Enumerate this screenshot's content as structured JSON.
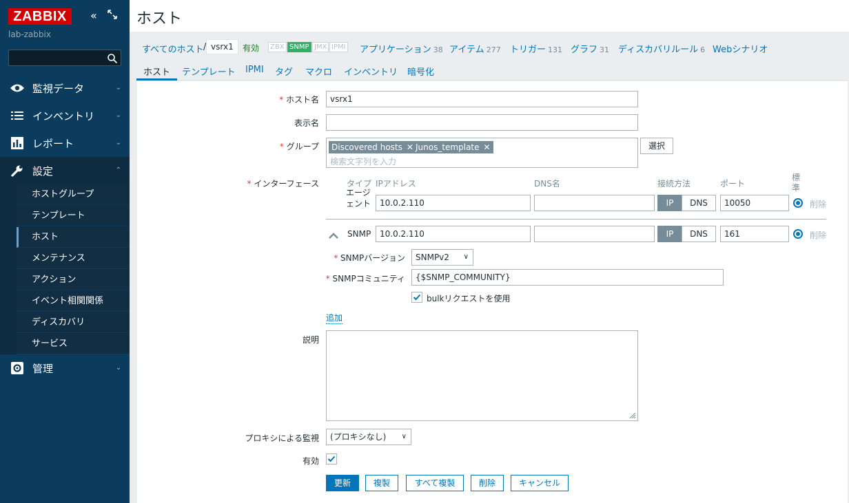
{
  "sidebar": {
    "logo": "ZABBIX",
    "server_name": "lab-zabbix",
    "collapse_glyph": "«",
    "sections": [
      {
        "label": "監視データ",
        "icon": "eye-icon"
      },
      {
        "label": "インベントリ",
        "icon": "list-icon"
      },
      {
        "label": "レポート",
        "icon": "bar-chart-icon"
      },
      {
        "label": "設定",
        "icon": "wrench-icon"
      },
      {
        "label": "管理",
        "icon": "gear-icon"
      }
    ],
    "config_items": [
      "ホストグループ",
      "テンプレート",
      "ホスト",
      "メンテナンス",
      "アクション",
      "イベント相関関係",
      "ディスカバリ",
      "サービス"
    ],
    "active_item": "ホスト"
  },
  "header": {
    "title": "ホスト"
  },
  "breadcrumb": {
    "all_hosts": "すべてのホスト",
    "separator": "/",
    "current": "vsrx1",
    "status": "有効",
    "availability": [
      "ZBX",
      "SNMP",
      "JMX",
      "IPMI"
    ],
    "links": [
      {
        "label": "アプリケーション",
        "count": "38"
      },
      {
        "label": "アイテム",
        "count": "277"
      },
      {
        "label": "トリガー",
        "count": "131"
      },
      {
        "label": "グラフ",
        "count": "31"
      },
      {
        "label": "ディスカバリルール",
        "count": "6"
      },
      {
        "label": "Webシナリオ",
        "count": ""
      }
    ]
  },
  "tabs": [
    "ホスト",
    "テンプレート",
    "IPMI",
    "タグ",
    "マクロ",
    "インベントリ",
    "暗号化"
  ],
  "form": {
    "host_name_label": "ホスト名",
    "host_name_value": "vsrx1",
    "visible_name_label": "表示名",
    "groups_label": "グループ",
    "groups": [
      "Discovered hosts",
      "Junos_template"
    ],
    "groups_placeholder": "検索文字列を入力",
    "select_button": "選択",
    "interfaces_label": "インターフェース",
    "iface_headers": {
      "type": "タイプ",
      "ip": "IPアドレス",
      "dns": "DNS名",
      "connect": "接続方法",
      "port": "ポート",
      "default": "標準"
    },
    "interfaces": [
      {
        "type": "エージェント",
        "ip": "10.0.2.110",
        "dns": "",
        "connect_ip": "IP",
        "connect_dns": "DNS",
        "port": "10050",
        "remove": "削除"
      },
      {
        "type": "SNMP",
        "ip": "10.0.2.110",
        "dns": "",
        "connect_ip": "IP",
        "connect_dns": "DNS",
        "port": "161",
        "remove": "削除"
      }
    ],
    "snmp_version_label": "SNMPバージョン",
    "snmp_version_value": "SNMPv2",
    "snmp_community_label": "SNMPコミュニティ",
    "snmp_community_value": "{$SNMP_COMMUNITY}",
    "bulk_label": "bulkリクエストを使用",
    "add_link": "追加",
    "description_label": "説明",
    "proxy_label": "プロキシによる監視",
    "proxy_value": "(プロキシなし)",
    "enabled_label": "有効"
  },
  "buttons": {
    "update": "更新",
    "clone": "複製",
    "full_clone": "すべて複製",
    "delete": "削除",
    "cancel": "キャンセル"
  },
  "colors": {
    "sidebar": "#0b3c5d",
    "logo": "#d40000",
    "link": "#0275b8",
    "snmp_available": "#34af67",
    "enabled_status": "#1f7c1f"
  }
}
